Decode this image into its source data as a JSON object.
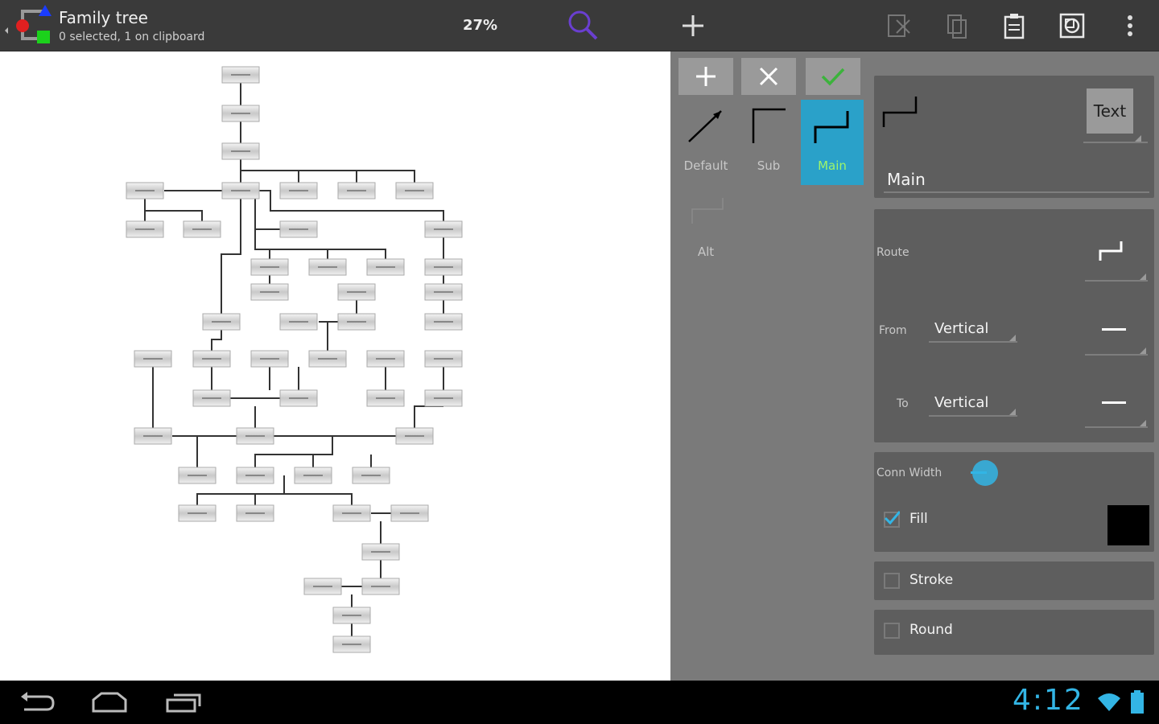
{
  "app": {
    "title": "Family tree",
    "subtitle": "0 selected, 1 on clipboard",
    "zoom": "27%"
  },
  "actionbar": {
    "icons": [
      "search-icon",
      "add-icon",
      "cut-icon",
      "copy-icon",
      "paste-icon",
      "layers-icon",
      "overflow-menu-icon"
    ]
  },
  "panel": {
    "tools": [
      "add-icon",
      "close-icon",
      "check-icon"
    ],
    "line_styles": [
      {
        "label": "Default",
        "selected": false
      },
      {
        "label": "Sub",
        "selected": false
      },
      {
        "label": "Main",
        "selected": true
      },
      {
        "label": "Alt",
        "selected": false
      }
    ],
    "style_card": {
      "text_button": "Text",
      "name_value": "Main"
    },
    "route_card": {
      "route_label": "Route",
      "from_label": "From",
      "from_value": "Vertical",
      "to_label": "To",
      "to_value": "Vertical"
    },
    "width_card": {
      "label": "Conn Width",
      "fill_label": "Fill",
      "fill_checked": true,
      "fill_color": "#000000"
    },
    "stroke": {
      "label": "Stroke",
      "checked": false
    },
    "round": {
      "label": "Round",
      "checked": false
    }
  },
  "status": {
    "clock": "4:12"
  },
  "colors": {
    "accent": "#33b5e5",
    "selected_bg": "#2aa1c9",
    "selected_text": "#9ff56a",
    "check_green": "#4caf50"
  }
}
